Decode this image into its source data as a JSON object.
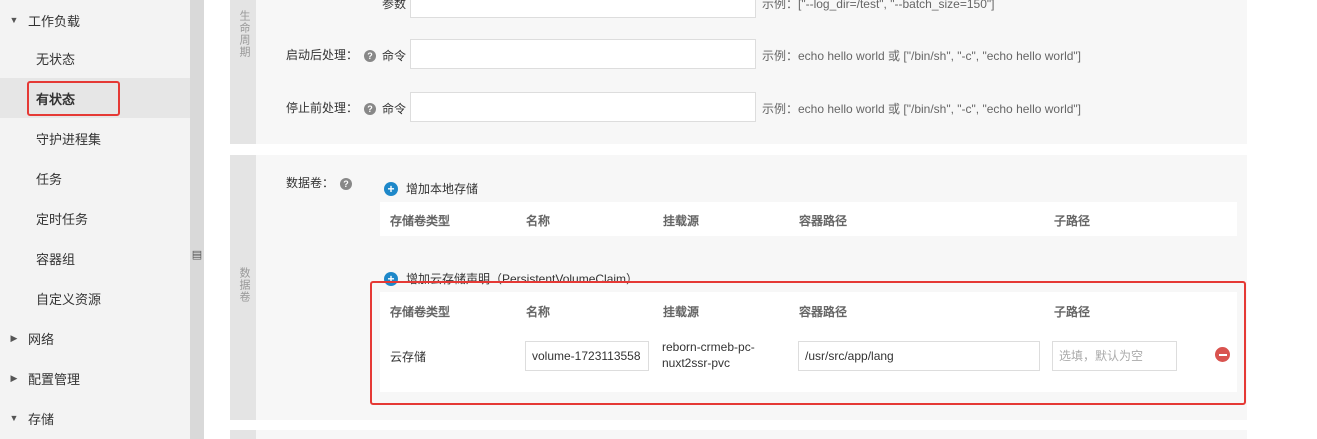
{
  "sidebar": {
    "workload": "工作负载",
    "items": [
      "无状态",
      "有状态",
      "守护进程集",
      "任务",
      "定时任务",
      "容器组",
      "自定义资源"
    ],
    "network": "网络",
    "config": "配置管理",
    "storage": "存储"
  },
  "lifecycle": {
    "tab_label": "生命周期",
    "params_label": "参数",
    "params_hint": "示例：[\"--log_dir=/test\", \"--batch_size=150\"]",
    "post_start_label": "启动后处理：",
    "pre_stop_label": "停止前处理：",
    "command_label": "命令",
    "command_hint": "示例：echo hello world 或 [\"/bin/sh\", \"-c\", \"echo hello world\"]"
  },
  "volumes": {
    "tab_label": "数据卷",
    "field_label": "数据卷：",
    "add_local": "增加本地存储",
    "add_pvc": "增加云存储声明（PersistentVolumeClaim）",
    "columns": [
      "存储卷类型",
      "名称",
      "挂载源",
      "容器路径",
      "子路径"
    ],
    "row": {
      "type": "云存储",
      "name": "volume-1723113558",
      "source_line1": "reborn-crmeb-pc-",
      "source_line2": "nuxt2ssr-pvc",
      "container_path": "/usr/src/app/lang",
      "subpath_placeholder": "选填，默认为空"
    }
  }
}
